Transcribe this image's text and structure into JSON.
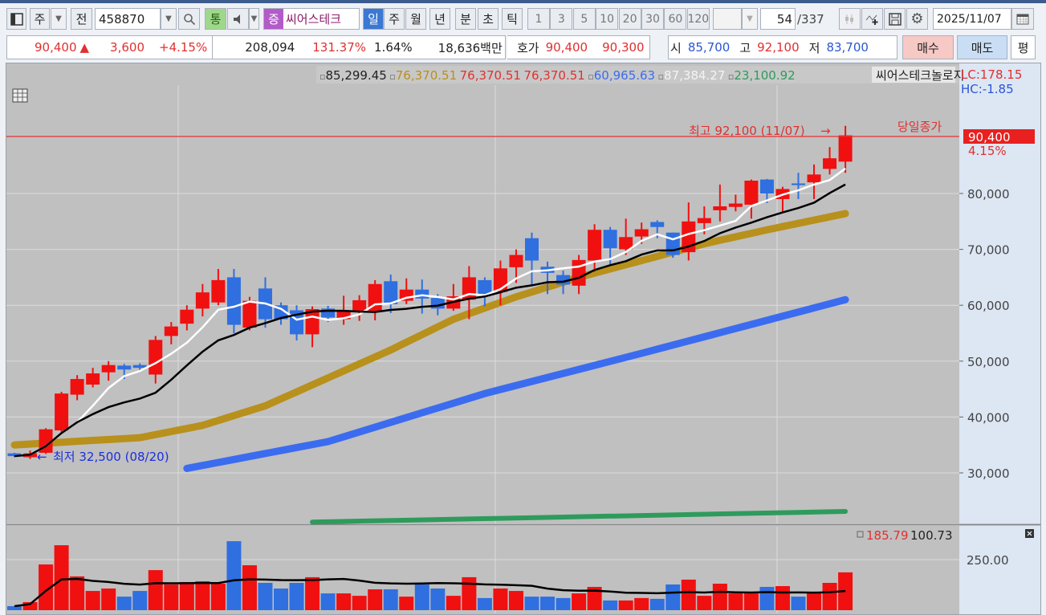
{
  "toolbar": {
    "market": "주",
    "all": "전",
    "code": "458870",
    "volume_btn": "통",
    "badge": "증",
    "stock_name": "씨어스테크",
    "periods": [
      "일",
      "주",
      "월",
      "년",
      "분",
      "초",
      "틱"
    ],
    "active_period": "일",
    "intervals": [
      "1",
      "3",
      "5",
      "10",
      "20",
      "30",
      "60",
      "120"
    ],
    "count": "54",
    "total": "/337",
    "date": "2025/11/07"
  },
  "quote": {
    "price": "90,400",
    "arrow": "▲",
    "change": "3,600",
    "change_pct": "+4.15%",
    "volume": "208,094",
    "vol_ratio": "131.37%",
    "turnover": "1.64%",
    "amount": "18,636백만",
    "hoga_label": "호가",
    "ask": "90,400",
    "bid": "90,300",
    "open_label": "시",
    "open": "85,700",
    "high_label": "고",
    "high": "92,100",
    "low_label": "저",
    "low": "83,700",
    "buy": "매수",
    "sell": "매도",
    "eval": "평"
  },
  "legend": {
    "items": [
      {
        "text": "85,299.45",
        "color": "#222222"
      },
      {
        "text": "76,370.51",
        "color": "#b8901c"
      },
      {
        "text": "76,370.51",
        "color": "#e03030"
      },
      {
        "text": "76,370.51",
        "color": "#e03030"
      },
      {
        "text": "60,965.63",
        "color": "#3b6cf0"
      },
      {
        "text": "87,384.27",
        "color": "#f4f4f4"
      },
      {
        "text": "23,100.92",
        "color": "#2e9b5c"
      }
    ],
    "name": "씨어스테크놀로지",
    "lc": "LC:178.15",
    "hc": "HC:-1.85"
  },
  "annotations": {
    "high": "최고 92,100 (11/07)",
    "low": "최저 32,500 (08/20)",
    "close_label": "당일종가",
    "last_price": "90,400",
    "last_pct": "4.15%"
  },
  "axis": {
    "price_ticks": [
      "80,000",
      "70,000",
      "60,000",
      "50,000",
      "40,000",
      "30,000"
    ],
    "volume_tick": "250.00"
  },
  "volume_legend": {
    "v1": "185.79",
    "v2": "100.73"
  },
  "chart_data": {
    "type": "candlestick",
    "price_unit": "thousand KRW",
    "ylim": [
      21,
      94
    ],
    "candles": [
      [
        33.5,
        33.6,
        32.8,
        33.0
      ],
      [
        32.8,
        34.0,
        32.5,
        33.5
      ],
      [
        33.6,
        38.0,
        33.4,
        37.8
      ],
      [
        37.6,
        44.5,
        37.2,
        44.2
      ],
      [
        44.0,
        47.5,
        43.0,
        46.8
      ],
      [
        45.8,
        48.8,
        45.3,
        47.8
      ],
      [
        48.0,
        50.0,
        46.5,
        49.3
      ],
      [
        49.2,
        49.5,
        46.8,
        48.5
      ],
      [
        49.3,
        49.6,
        48.4,
        48.8
      ],
      [
        47.6,
        54.5,
        46.0,
        53.8
      ],
      [
        54.5,
        57.0,
        53.0,
        56.2
      ],
      [
        56.7,
        60.0,
        55.5,
        59.2
      ],
      [
        59.4,
        63.8,
        58.0,
        62.3
      ],
      [
        60.5,
        66.5,
        60.0,
        64.5
      ],
      [
        65.0,
        66.5,
        55.0,
        56.5
      ],
      [
        56.0,
        61.5,
        55.5,
        60.8
      ],
      [
        63.0,
        65.0,
        56.0,
        57.5
      ],
      [
        60.0,
        60.5,
        56.5,
        57.5
      ],
      [
        59.1,
        60.0,
        53.7,
        54.8
      ],
      [
        54.8,
        59.8,
        52.5,
        59.3
      ],
      [
        59.4,
        59.9,
        57.0,
        57.8
      ],
      [
        57.5,
        61.7,
        56.5,
        59.0
      ],
      [
        58.8,
        61.8,
        57.2,
        60.9
      ],
      [
        59.0,
        64.5,
        57.3,
        63.8
      ],
      [
        64.3,
        65.5,
        58.6,
        60.2
      ],
      [
        60.8,
        64.8,
        60.2,
        62.8
      ],
      [
        62.8,
        64.6,
        58.5,
        61.2
      ],
      [
        61.3,
        62.0,
        58.2,
        59.4
      ],
      [
        59.4,
        63.8,
        59.0,
        61.6
      ],
      [
        61.0,
        67.0,
        57.5,
        65.0
      ],
      [
        64.5,
        65.0,
        59.8,
        61.8
      ],
      [
        62.4,
        68.0,
        60.0,
        66.6
      ],
      [
        66.8,
        70.0,
        64.0,
        69.0
      ],
      [
        72.0,
        73.0,
        63.5,
        68.0
      ],
      [
        66.9,
        67.8,
        62.0,
        65.8
      ],
      [
        65.4,
        66.2,
        62.0,
        63.7
      ],
      [
        63.5,
        69.0,
        62.0,
        68.1
      ],
      [
        68.0,
        74.5,
        66.0,
        73.5
      ],
      [
        73.5,
        74.0,
        67.0,
        70.2
      ],
      [
        70.0,
        75.5,
        69.0,
        72.2
      ],
      [
        72.3,
        74.8,
        71.0,
        73.6
      ],
      [
        74.9,
        75.2,
        72.0,
        74.0
      ],
      [
        73.0,
        73.0,
        68.5,
        69.0
      ],
      [
        69.5,
        78.4,
        68.0,
        75.0
      ],
      [
        74.7,
        77.7,
        72.7,
        75.6
      ],
      [
        77.0,
        81.6,
        75.0,
        77.7
      ],
      [
        77.6,
        79.8,
        76.8,
        78.2
      ],
      [
        78.0,
        82.5,
        75.5,
        82.3
      ],
      [
        82.5,
        82.6,
        78.3,
        80.0
      ],
      [
        79.0,
        81.2,
        76.5,
        80.8
      ],
      [
        81.8,
        83.7,
        79.0,
        81.5
      ],
      [
        82.0,
        85.2,
        79.0,
        83.4
      ],
      [
        84.4,
        88.3,
        83.4,
        86.3
      ],
      [
        85.7,
        92.1,
        83.7,
        90.4
      ]
    ],
    "candle_fields": [
      "open",
      "high",
      "low",
      "close"
    ],
    "ma_lines": [
      {
        "name": "ma-long-gold",
        "color": "#b8901c",
        "points": [
          [
            0,
            35.0
          ],
          [
            8,
            36.3
          ],
          [
            12,
            38.5
          ],
          [
            16,
            42
          ],
          [
            20,
            47
          ],
          [
            24,
            52
          ],
          [
            28,
            57.5
          ],
          [
            32,
            61.5
          ],
          [
            36,
            65
          ],
          [
            40,
            68
          ],
          [
            44,
            71
          ],
          [
            48,
            73.5
          ],
          [
            53,
            76.4
          ]
        ]
      },
      {
        "name": "ma-long-blue",
        "color": "#3b6cf0",
        "points": [
          [
            11,
            30.8
          ],
          [
            20,
            35.6
          ],
          [
            30,
            44.2
          ],
          [
            40,
            51.4
          ],
          [
            53,
            61.0
          ]
        ]
      },
      {
        "name": "ma-long-green",
        "color": "#2e9b5c",
        "points": [
          [
            19,
            21.2
          ],
          [
            53,
            23.1
          ]
        ]
      }
    ],
    "volume": [
      20,
      40,
      226,
      321,
      167,
      95,
      107,
      67,
      95,
      198,
      127,
      139,
      143,
      131,
      341,
      222,
      135,
      107,
      135,
      163,
      83,
      83,
      71,
      103,
      103,
      67,
      127,
      107,
      71,
      163,
      60,
      107,
      95,
      67,
      67,
      60,
      83,
      115,
      48,
      48,
      60,
      56,
      127,
      151,
      71,
      131,
      83,
      83,
      115,
      119,
      67,
      91,
      135,
      187
    ],
    "volume_up": [
      0,
      1,
      1,
      1,
      1,
      1,
      1,
      0,
      0,
      1,
      1,
      1,
      1,
      1,
      0,
      1,
      0,
      0,
      0,
      1,
      0,
      1,
      1,
      1,
      0,
      1,
      0,
      0,
      1,
      1,
      0,
      1,
      1,
      0,
      0,
      0,
      1,
      1,
      0,
      1,
      1,
      0,
      0,
      1,
      1,
      1,
      1,
      1,
      0,
      1,
      0,
      1,
      1,
      1
    ],
    "colors": {
      "up": "#f01010",
      "down": "#2f6fe0",
      "bg": "#c0c0c0",
      "axis_bg": "#dde6f3"
    }
  }
}
